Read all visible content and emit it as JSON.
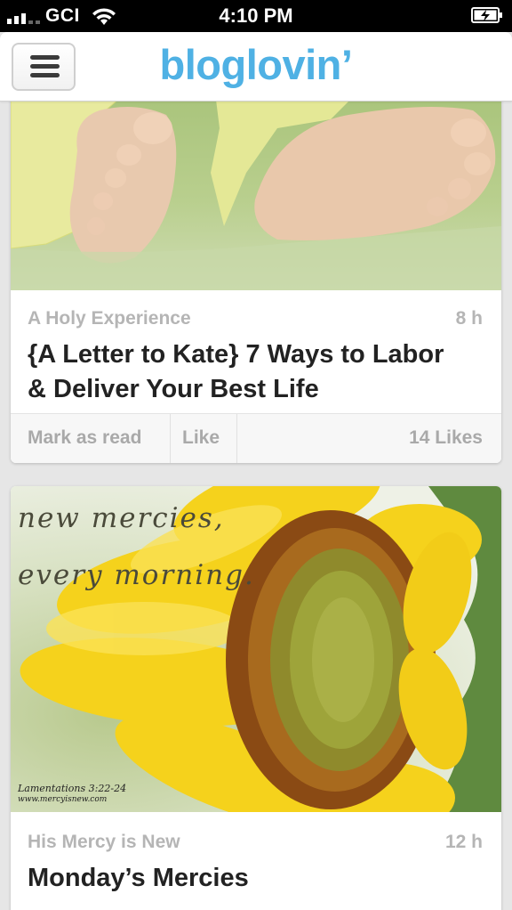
{
  "status_bar": {
    "carrier": "GCI",
    "time": "4:10 PM"
  },
  "header": {
    "logo": "bloglovin’"
  },
  "posts": [
    {
      "blog": "A Holy Experience",
      "age": "8 h",
      "title_line1": "{A Letter to Kate} 7 Ways to Labor",
      "title_line2": "& Deliver Your Best Life",
      "mark_as_read": "Mark as read",
      "like": "Like",
      "likes_count": "14 Likes"
    },
    {
      "blog": "His Mercy is New",
      "age": "12 h",
      "title": "Monday’s Mercies",
      "image_text_line1": "new mercies,",
      "image_text_line2": "every morning.",
      "image_credit_line1": "Lamentations 3:22-24",
      "image_credit_line2": "www.mercyisnew.com"
    }
  ]
}
